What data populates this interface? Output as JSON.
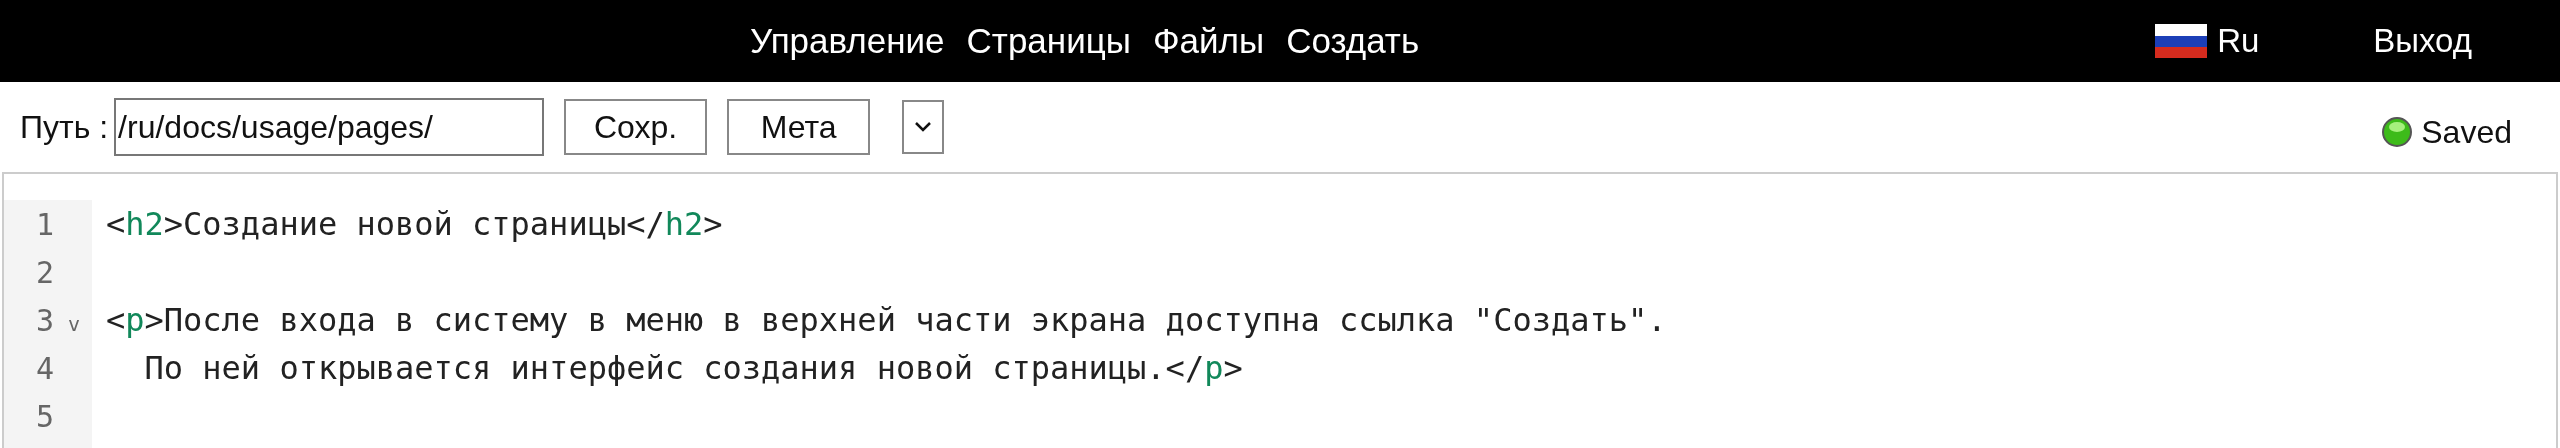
{
  "top_nav": {
    "items": [
      "Управление",
      "Страницы",
      "Файлы",
      "Создать"
    ],
    "language": "Ru",
    "logout": "Выход"
  },
  "toolbar": {
    "path_label": "Путь :",
    "path_value": "/ru/docs/usage/pages/",
    "buttons": [
      "Сохр.",
      "Мета"
    ],
    "status": "Saved",
    "saved": true
  },
  "editor": {
    "lines": [
      {
        "number": "1",
        "tokens": [
          {
            "kind": "punct",
            "text": "<"
          },
          {
            "kind": "tag",
            "text": "h2"
          },
          {
            "kind": "punct",
            "text": ">Создание новой страницы</"
          },
          {
            "kind": "tag",
            "text": "h2"
          },
          {
            "kind": "punct",
            "text": ">"
          }
        ]
      },
      {
        "number": "2"
      },
      {
        "number": "3",
        "fold_marker": "v",
        "tokens": [
          {
            "kind": "punct",
            "text": "<"
          },
          {
            "kind": "tag",
            "text": "p"
          },
          {
            "kind": "punct",
            "text": ">После входа в систему в меню в верхней части экрана доступна ссылка \"Создать\"."
          }
        ]
      },
      {
        "number": "4",
        "tokens": [
          {
            "kind": "punct",
            "text": "  По ней открывается интерфейс создания новой страницы.</"
          },
          {
            "kind": "tag",
            "text": "p"
          },
          {
            "kind": "punct",
            "text": ">"
          }
        ]
      },
      {
        "number": "5"
      }
    ]
  }
}
